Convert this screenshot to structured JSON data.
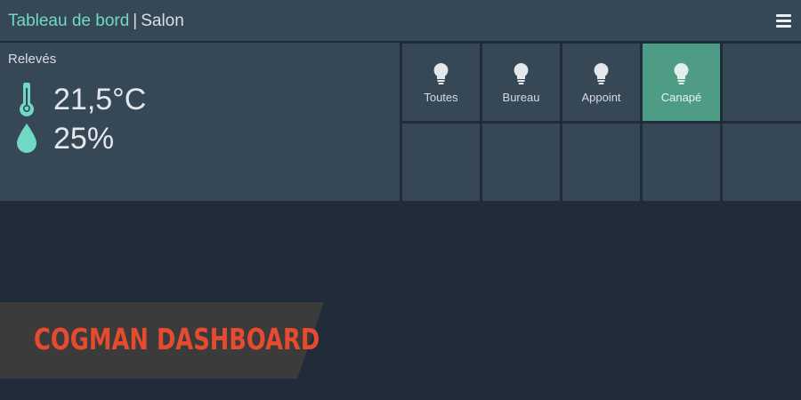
{
  "header": {
    "title_accent": "Tableau de bord",
    "separator": "|",
    "room": "Salon",
    "menu_icon": "hamburger-menu-icon"
  },
  "readings": {
    "title": "Relevés",
    "temperature": {
      "icon": "thermometer-icon",
      "value": "21,5°C"
    },
    "humidity": {
      "icon": "water-drop-icon",
      "value": "25%"
    }
  },
  "lights": {
    "tiles": [
      {
        "label": "Toutes",
        "icon": "lightbulb-icon",
        "active": false
      },
      {
        "label": "Bureau",
        "icon": "lightbulb-icon",
        "active": false
      },
      {
        "label": "Appoint",
        "icon": "lightbulb-icon",
        "active": false
      },
      {
        "label": "Canapé",
        "icon": "lightbulb-icon",
        "active": true
      }
    ]
  },
  "brand": {
    "text": "COGMAN DASHBOARD"
  },
  "colors": {
    "accent": "#6fd9c4",
    "active_tile": "#4f9c86",
    "panel": "#364856",
    "background": "#202c39",
    "brand": "#e64a2f"
  }
}
